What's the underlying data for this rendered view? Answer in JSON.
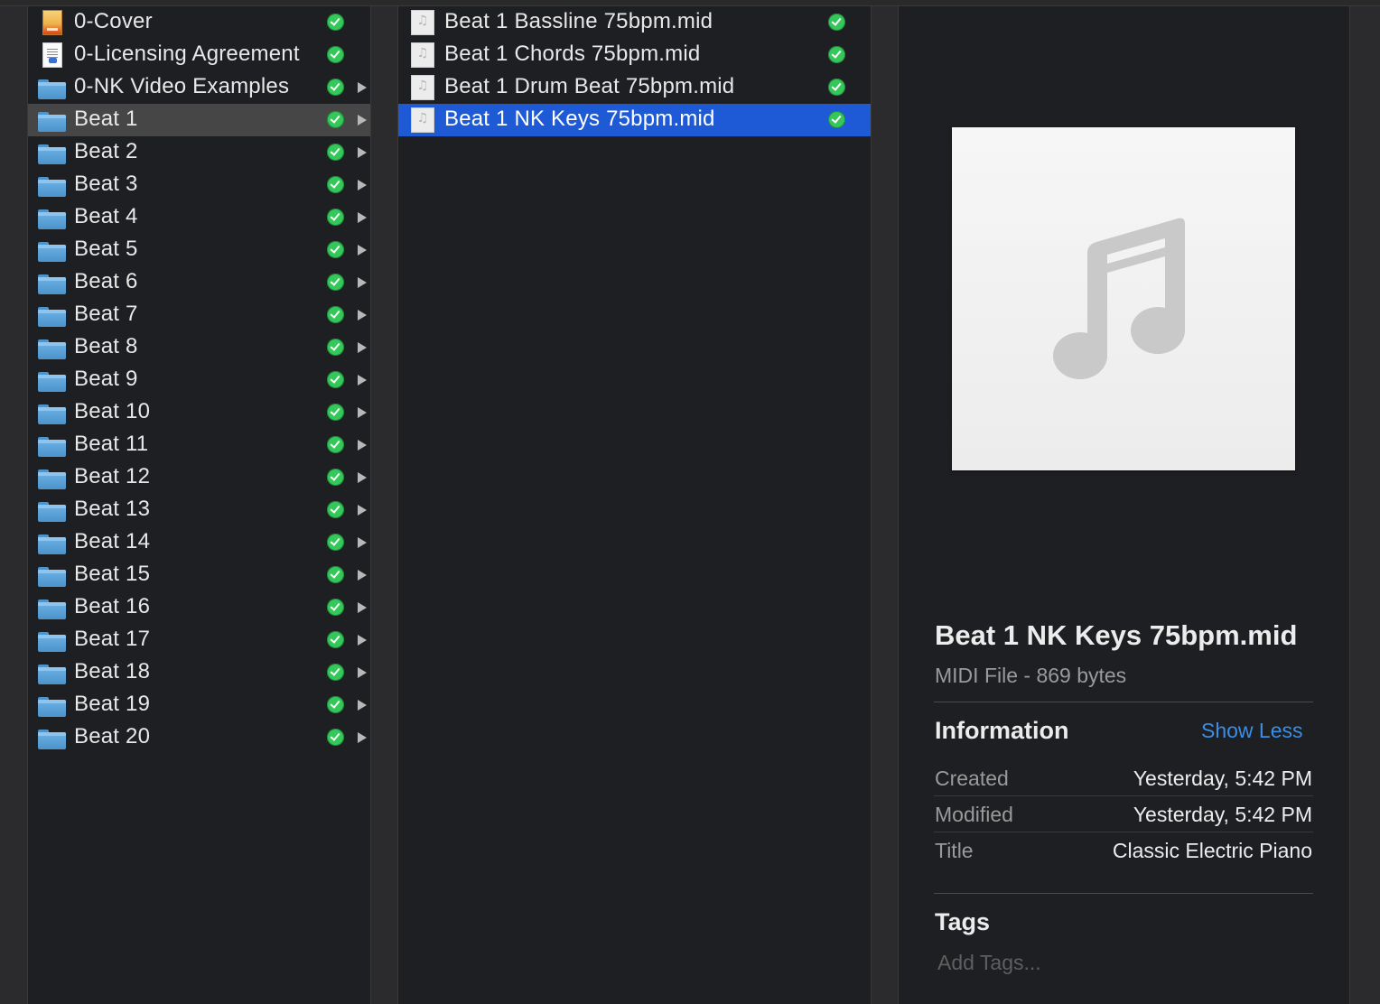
{
  "column1": {
    "items": [
      {
        "label": "0-Cover",
        "icon": "cover-document-icon",
        "type": "cover",
        "disclosure": false
      },
      {
        "label": "0-Licensing Agreement",
        "icon": "text-document-icon",
        "type": "text",
        "disclosure": false
      },
      {
        "label": "0-NK Video Examples",
        "icon": "folder-icon",
        "type": "folder",
        "disclosure": true
      },
      {
        "label": "Beat 1",
        "icon": "folder-icon",
        "type": "folder",
        "disclosure": true,
        "selected": true
      },
      {
        "label": "Beat 2",
        "icon": "folder-icon",
        "type": "folder",
        "disclosure": true
      },
      {
        "label": "Beat 3",
        "icon": "folder-icon",
        "type": "folder",
        "disclosure": true
      },
      {
        "label": "Beat 4",
        "icon": "folder-icon",
        "type": "folder",
        "disclosure": true
      },
      {
        "label": "Beat 5",
        "icon": "folder-icon",
        "type": "folder",
        "disclosure": true
      },
      {
        "label": "Beat 6",
        "icon": "folder-icon",
        "type": "folder",
        "disclosure": true
      },
      {
        "label": "Beat 7",
        "icon": "folder-icon",
        "type": "folder",
        "disclosure": true
      },
      {
        "label": "Beat 8",
        "icon": "folder-icon",
        "type": "folder",
        "disclosure": true
      },
      {
        "label": "Beat 9",
        "icon": "folder-icon",
        "type": "folder",
        "disclosure": true
      },
      {
        "label": "Beat 10",
        "icon": "folder-icon",
        "type": "folder",
        "disclosure": true
      },
      {
        "label": "Beat 11",
        "icon": "folder-icon",
        "type": "folder",
        "disclosure": true
      },
      {
        "label": "Beat 12",
        "icon": "folder-icon",
        "type": "folder",
        "disclosure": true
      },
      {
        "label": "Beat 13",
        "icon": "folder-icon",
        "type": "folder",
        "disclosure": true
      },
      {
        "label": "Beat 14",
        "icon": "folder-icon",
        "type": "folder",
        "disclosure": true
      },
      {
        "label": "Beat 15",
        "icon": "folder-icon",
        "type": "folder",
        "disclosure": true
      },
      {
        "label": "Beat 16",
        "icon": "folder-icon",
        "type": "folder",
        "disclosure": true
      },
      {
        "label": "Beat 17",
        "icon": "folder-icon",
        "type": "folder",
        "disclosure": true
      },
      {
        "label": "Beat 18",
        "icon": "folder-icon",
        "type": "folder",
        "disclosure": true
      },
      {
        "label": "Beat 19",
        "icon": "folder-icon",
        "type": "folder",
        "disclosure": true
      },
      {
        "label": "Beat 20",
        "icon": "folder-icon",
        "type": "folder",
        "disclosure": true
      }
    ]
  },
  "column2": {
    "items": [
      {
        "label": "Beat 1 Bassline 75bpm.mid",
        "icon": "midi-file-icon"
      },
      {
        "label": "Beat 1 Chords 75bpm.mid",
        "icon": "midi-file-icon"
      },
      {
        "label": "Beat 1 Drum Beat 75bpm.mid",
        "icon": "midi-file-icon"
      },
      {
        "label": "Beat 1 NK Keys 75bpm.mid",
        "icon": "midi-file-icon",
        "selected": true
      }
    ]
  },
  "preview": {
    "icon": "music-note-icon",
    "file_name": "Beat 1 NK Keys 75bpm.mid",
    "kind_size": "MIDI File - 869 bytes",
    "information_heading": "Information",
    "show_less_label": "Show Less",
    "info": {
      "created_label": "Created",
      "created_value": "Yesterday, 5:42 PM",
      "modified_label": "Modified",
      "modified_value": "Yesterday, 5:42 PM",
      "title_label": "Title",
      "title_value": "Classic Electric Piano"
    },
    "tags_heading": "Tags",
    "tags_placeholder": "Add Tags..."
  },
  "colors": {
    "selection_active": "#1e5ad6",
    "selection_inactive": "#464646",
    "sync_check": "#34c759",
    "link": "#3b8ee6"
  }
}
